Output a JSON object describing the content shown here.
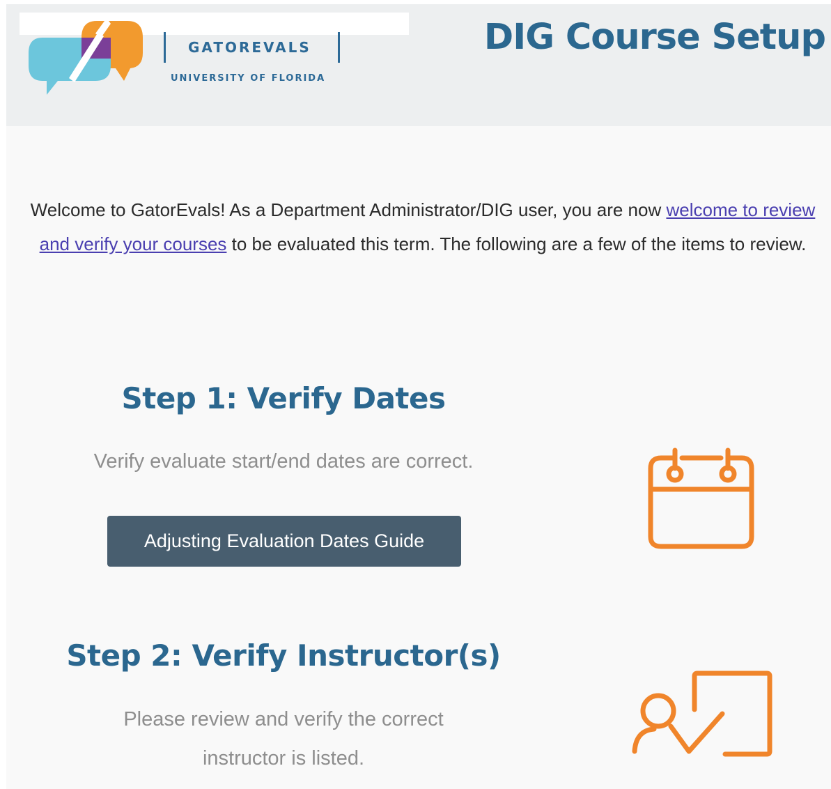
{
  "header": {
    "logo_word": "GATOREVALS",
    "logo_sub": "UNIVERSITY OF FLORIDA",
    "title": "DIG Course Setup"
  },
  "intro": {
    "text_before": "Welcome to GatorEvals! As a Department Administrator/DIG user, you are now ",
    "link_text": "welcome to review and verify your courses",
    "text_after": " to be evaluated this term. The following are a few of the items to review."
  },
  "steps": [
    {
      "title": "Step 1: Verify Dates",
      "description": "Verify evaluate start/end dates are correct.",
      "button_label": "Adjusting Evaluation Dates Guide",
      "icon": "calendar-icon"
    },
    {
      "title": "Step 2: Verify Instructor(s)",
      "description_line1": "Please review and verify the correct",
      "description_line2": "instructor is listed.",
      "icon": "instructor-check-icon"
    }
  ],
  "colors": {
    "brand_blue": "#2b678f",
    "accent_orange": "#f0852b",
    "button_bg": "#485e6f",
    "logo_orange": "#f29a2e",
    "logo_cyan": "#6cc6dc",
    "logo_purple": "#7b3f98"
  }
}
